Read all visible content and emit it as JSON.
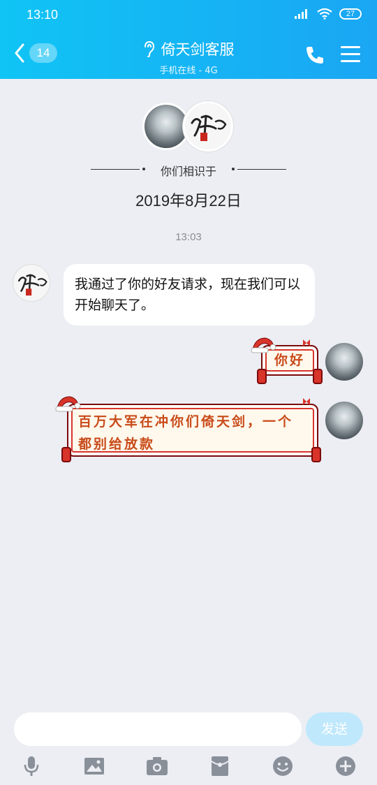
{
  "status_bar": {
    "time": "13:10",
    "battery": "27"
  },
  "header": {
    "back_count": "14",
    "title": "倚天剑客服",
    "subtitle": "手机在线 - 4G"
  },
  "intro": {
    "met_text": "你们相识于",
    "met_date": "2019年8月22日"
  },
  "chat": {
    "timestamp": "13:03",
    "messages": [
      {
        "side": "left",
        "text": "我通过了你的好友请求，现在我们可以开始聊天了。"
      },
      {
        "side": "right",
        "text": "你好"
      },
      {
        "side": "right",
        "text": "百万大军在冲你们倚天剑，一个都别给放款"
      }
    ]
  },
  "composer": {
    "input_value": "",
    "send_label": "发送"
  },
  "toolbar": {
    "icons": [
      "microphone-icon",
      "image-icon",
      "camera-icon",
      "red-packet-icon",
      "emoji-icon",
      "plus-icon"
    ]
  },
  "colors": {
    "header_start": "#10c4f5",
    "header_end": "#1aa6f3",
    "send_disabled": "#bfe8fc",
    "xmas_text": "#c84a18",
    "xmas_border": "#d8342a"
  }
}
